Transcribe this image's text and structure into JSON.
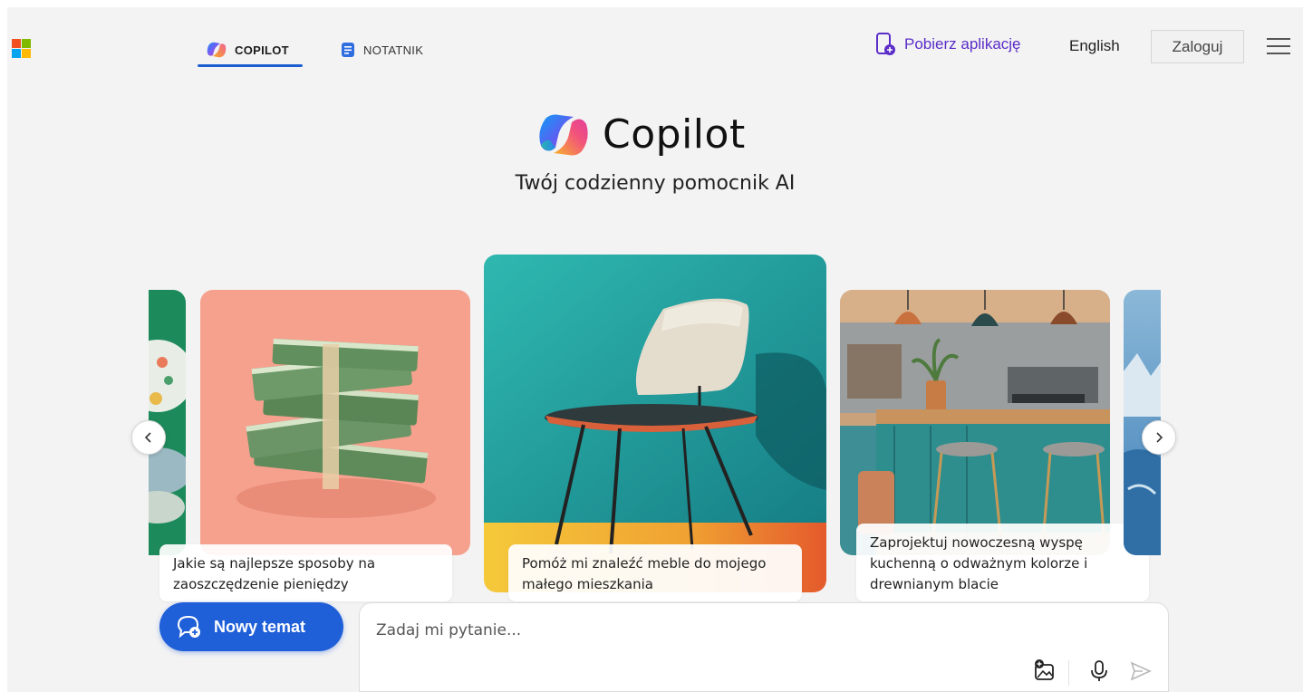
{
  "header": {
    "tabs": [
      {
        "label": "COPILOT",
        "active": true
      },
      {
        "label": "NOTATNIK",
        "active": false
      }
    ],
    "get_app_label": "Pobierz aplikację",
    "language_label": "English",
    "login_label": "Zaloguj"
  },
  "hero": {
    "title": "Copilot",
    "subtitle": "Twój codzienny pomocnik AI"
  },
  "carousel": {
    "cards": [
      {
        "caption": "",
        "image": "partial-green-plate"
      },
      {
        "caption": "Jakie są najlepsze sposoby na zaoszczędzenie pieniędzy",
        "image": "stacks-of-dollar-bills"
      },
      {
        "caption": "Pomóż mi znaleźć meble do mojego małego mieszkania",
        "image": "modern-chair-teal-wall"
      },
      {
        "caption": "Zaprojektuj nowoczesną wyspę kuchenną o odważnym kolorze i drewnianym blacie",
        "image": "kitchen-island-teal"
      },
      {
        "caption": "",
        "image": "partial-blue-landscape"
      }
    ]
  },
  "composer": {
    "new_topic_label": "Nowy temat",
    "placeholder": "Zadaj mi pytanie..."
  },
  "colors": {
    "accent_blue": "#1f5fd8",
    "tab_underline": "#1d5fd1",
    "get_app_purple": "#5a2dc8",
    "page_bg": "#f3f3f3"
  }
}
